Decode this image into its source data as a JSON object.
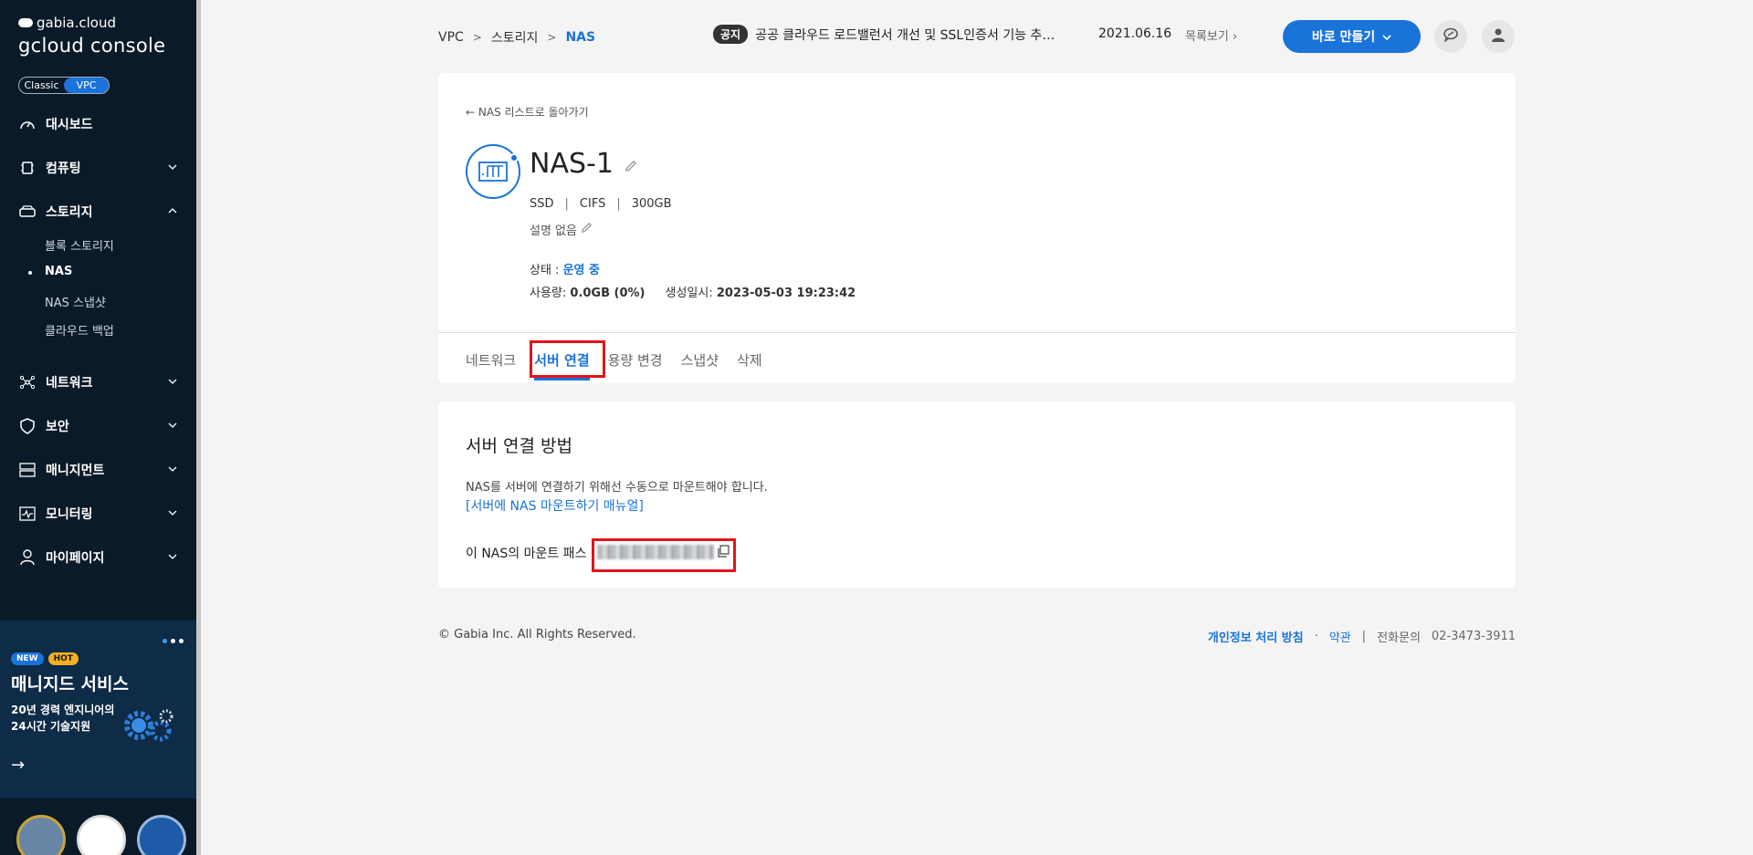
{
  "sidebar": {
    "brand_small": "gabia.cloud",
    "brand_main": "gcloud console",
    "mode_toggle": {
      "classic": "Classic",
      "vpc": "VPC"
    },
    "nav": {
      "dashboard": "대시보드",
      "computing": "컴퓨팅",
      "storage": "스토리지",
      "network": "네트워크",
      "security": "보안",
      "management": "매니지먼트",
      "monitoring": "모니터링",
      "mypage": "마이페이지"
    },
    "storage_sub": {
      "block": "블록 스토리지",
      "nas": "NAS",
      "nas_snapshot": "NAS 스냅샷",
      "cloud_backup": "클라우드 백업"
    },
    "promo": {
      "badge_new": "NEW",
      "badge_hot": "HOT",
      "title": "매니지드 서비스",
      "desc": "20년 경력 엔지니어의 24시간 기술지원"
    }
  },
  "header": {
    "breadcrumb": {
      "l1": "VPC",
      "l2": "스토리지",
      "l3": "NAS"
    },
    "notice": {
      "tag": "공지",
      "text": "공공 클라우드 로드밸런서 개선 및 SSL인증서 기능 추…",
      "date": "2021.06.16",
      "more": "목록보기"
    },
    "create_button": "바로 만들기"
  },
  "detail": {
    "back_link": "NAS 리스트로 돌아가기",
    "name": "NAS-1",
    "specs": {
      "disk": "SSD",
      "protocol": "CIFS",
      "size": "300GB"
    },
    "description": "설명 없음",
    "status_label": "상태 : ",
    "status_value": "운영 중",
    "usage_label": "사용량: ",
    "usage_value": "0.0GB (0%)",
    "created_label": "생성일시: ",
    "created_value": "2023-05-03 19:23:42",
    "tabs": {
      "network": "네트워크",
      "server_connect": "서버 연결",
      "resize": "용량 변경",
      "snapshot": "스냅샷",
      "delete": "삭제"
    }
  },
  "connect": {
    "title": "서버 연결 방법",
    "desc": "NAS를 서버에 연결하기 위해선 수동으로 마운트해야 합니다.",
    "manual_link": "[서버에 NAS 마운트하기 매뉴얼]",
    "mount_label": "이 NAS의 마운트 패스"
  },
  "footer": {
    "copyright": "© Gabia Inc. All Rights Reserved.",
    "privacy": "개인정보 처리 방침",
    "terms": "약관",
    "phone_label": "전화문의",
    "phone": "02-3473-3911"
  }
}
